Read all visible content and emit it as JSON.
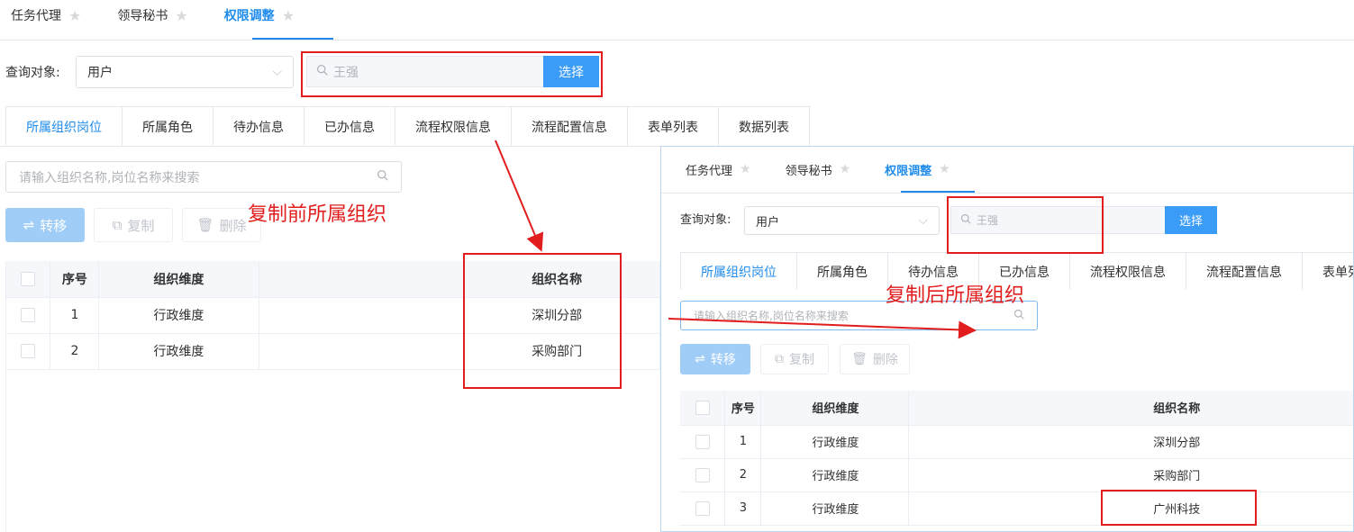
{
  "panel1": {
    "top_tabs": [
      {
        "label": "任务代理",
        "active": false
      },
      {
        "label": "领导秘书",
        "active": false
      },
      {
        "label": "权限调整",
        "active": true
      }
    ],
    "query_label": "查询对象:",
    "query_select": "用户",
    "search_placeholder": "王强",
    "select_button": "选择",
    "sub_tabs": [
      "所属组织岗位",
      "所属角色",
      "待办信息",
      "已办信息",
      "流程权限信息",
      "流程配置信息",
      "表单列表",
      "数据列表"
    ],
    "filter_placeholder": "请输入组织名称,岗位名称来搜索",
    "actions": {
      "transfer": "转移",
      "copy": "复制",
      "delete": "删除"
    },
    "table": {
      "headers": [
        "序号",
        "组织维度",
        "组织名称"
      ],
      "rows": [
        {
          "no": "1",
          "dimension": "行政维度",
          "name": "深圳分部"
        },
        {
          "no": "2",
          "dimension": "行政维度",
          "name": "采购部门"
        }
      ]
    },
    "annotation": "复制前所属组织"
  },
  "panel2": {
    "top_tabs": [
      {
        "label": "任务代理",
        "active": false
      },
      {
        "label": "领导秘书",
        "active": false
      },
      {
        "label": "权限调整",
        "active": true
      }
    ],
    "query_label": "查询对象:",
    "query_select": "用户",
    "search_placeholder": "王强",
    "select_button": "选择",
    "sub_tabs": [
      "所属组织岗位",
      "所属角色",
      "待办信息",
      "已办信息",
      "流程权限信息",
      "流程配置信息",
      "表单列表"
    ],
    "filter_placeholder": "请输入组织名称,岗位名称来搜索",
    "actions": {
      "transfer": "转移",
      "copy": "复制",
      "delete": "删除"
    },
    "table": {
      "headers": [
        "序号",
        "组织维度",
        "组织名称"
      ],
      "rows": [
        {
          "no": "1",
          "dimension": "行政维度",
          "name": "深圳分部"
        },
        {
          "no": "2",
          "dimension": "行政维度",
          "name": "采购部门"
        },
        {
          "no": "3",
          "dimension": "行政维度",
          "name": "广州科技"
        }
      ]
    },
    "annotation": "复制后所属组织"
  },
  "colors": {
    "accent": "#1f8cec",
    "annotation": "#e11d1d",
    "button": "#3a9cf6"
  }
}
